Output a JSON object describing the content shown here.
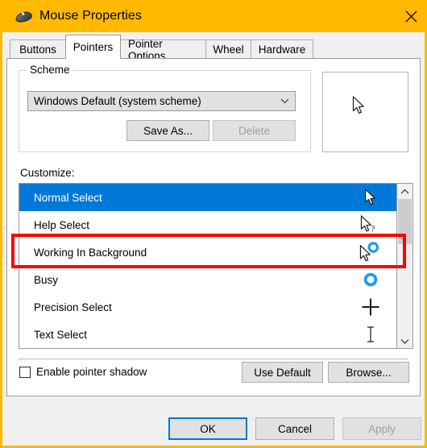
{
  "window": {
    "title": "Mouse Properties",
    "title_icon": "mouse-icon",
    "close_icon": "close-icon",
    "accent_color": "#ffb900",
    "selection_color": "#0078d7",
    "annotation_color": "#ff0000"
  },
  "tabs": [
    {
      "label": "Buttons",
      "active": false
    },
    {
      "label": "Pointers",
      "active": true
    },
    {
      "label": "Pointer Options",
      "active": false
    },
    {
      "label": "Wheel",
      "active": false
    },
    {
      "label": "Hardware",
      "active": false
    }
  ],
  "scheme": {
    "legend": "Scheme",
    "selected_value": "Windows Default (system scheme)",
    "dropdown_icon": "chevron-down-icon",
    "save_as_label": "Save As...",
    "delete_label": "Delete",
    "delete_disabled": true,
    "preview_cursor_icon": "arrow-cursor-icon"
  },
  "customize": {
    "label": "Customize:",
    "items": [
      {
        "label": "Normal Select",
        "cursor_icon": "arrow-cursor-icon",
        "selected": true
      },
      {
        "label": "Help Select",
        "cursor_icon": "arrow-help-cursor-icon",
        "selected": false
      },
      {
        "label": "Working In Background",
        "cursor_icon": "arrow-busy-cursor-icon",
        "selected": false
      },
      {
        "label": "Busy",
        "cursor_icon": "busy-ring-cursor-icon",
        "selected": false
      },
      {
        "label": "Precision Select",
        "cursor_icon": "crosshair-cursor-icon",
        "selected": false
      },
      {
        "label": "Text Select",
        "cursor_icon": "ibeam-cursor-icon",
        "selected": false
      }
    ],
    "scrollbar": {
      "up_icon": "chevron-up-icon",
      "down_icon": "chevron-down-icon"
    }
  },
  "options": {
    "shadow_label": "Enable pointer shadow",
    "shadow_checked": false,
    "use_default_label": "Use Default",
    "browse_label": "Browse..."
  },
  "footer": {
    "ok_label": "OK",
    "cancel_label": "Cancel",
    "apply_label": "Apply",
    "apply_disabled": true
  }
}
